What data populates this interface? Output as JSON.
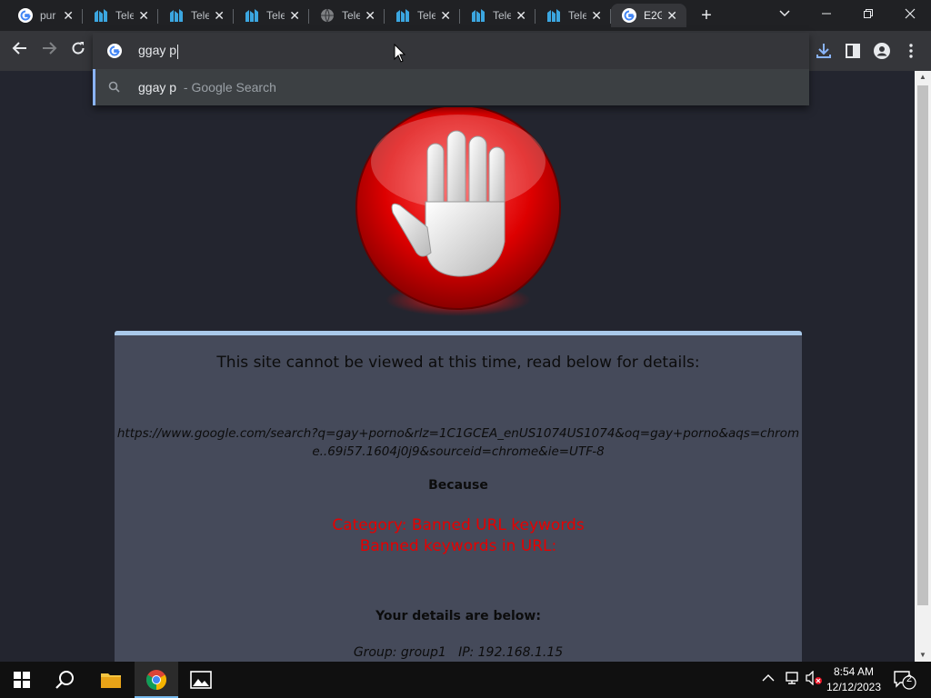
{
  "browser": {
    "tabs": [
      {
        "title": "pur",
        "favicon": "google-g-icon",
        "active": false
      },
      {
        "title": "Tele",
        "favicon": "telerik-icon",
        "active": false
      },
      {
        "title": "Tele",
        "favicon": "telerik-icon",
        "active": false
      },
      {
        "title": "Tele",
        "favicon": "telerik-icon",
        "active": false
      },
      {
        "title": "Tele",
        "favicon": "globe-icon",
        "active": false
      },
      {
        "title": "Tele",
        "favicon": "telerik-icon",
        "active": false
      },
      {
        "title": "Tele",
        "favicon": "telerik-icon",
        "active": false
      },
      {
        "title": "Tele",
        "favicon": "telerik-icon",
        "active": false
      },
      {
        "title": "E2G",
        "favicon": "google-g-icon",
        "active": true
      }
    ],
    "omnibox": {
      "value": "ggay p",
      "suggestion_query": "ggay p",
      "suggestion_source": " - Google Search"
    }
  },
  "page": {
    "headline": "This site cannot be viewed at this time, read below for details:",
    "blocked_url": "https://www.google.com/search?q=gay+porno&rlz=1C1GCEA_enUS1074US1074&oq=gay+porno&aqs=chrome..69i57.1604j0j9&sourceid=chrome&ie=UTF-8",
    "because_label": "Because",
    "category_line": "Category: Banned URL keywords",
    "keywords_line": "Banned keywords in URL:",
    "details_heading": "Your details are below:",
    "details_line": "Group: group1   IP: 192.168.1.15",
    "colors": {
      "accent_border": "#a9c9ea",
      "panel": "#454a5a",
      "alert": "#e60000"
    }
  },
  "taskbar": {
    "clock_time": "8:54 AM",
    "clock_date": "12/12/2023",
    "notification_count": "2"
  }
}
